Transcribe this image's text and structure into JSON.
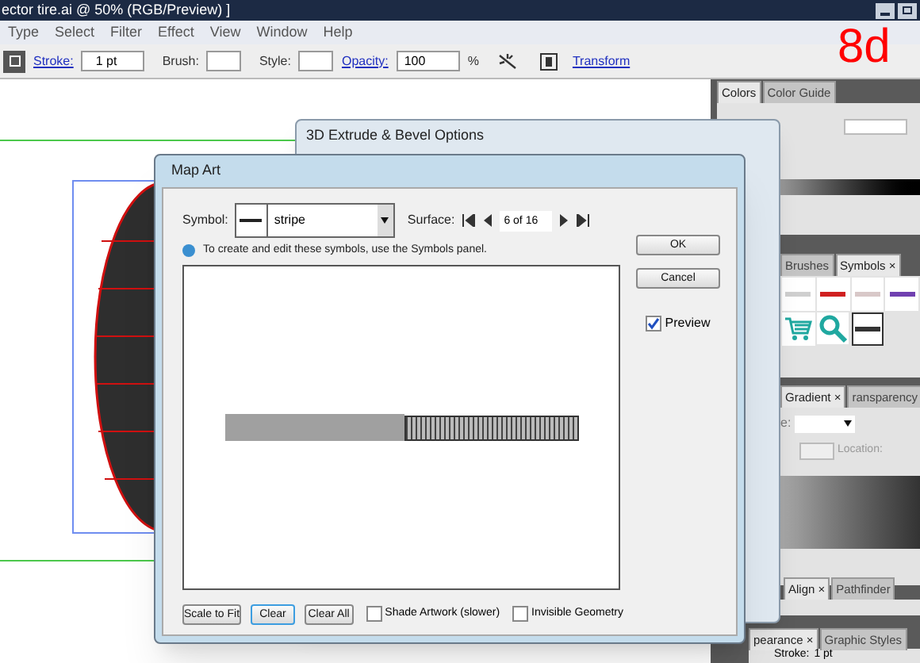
{
  "app_title": "ector tire.ai @ 50% (RGB/Preview) ]",
  "menu": [
    "Type",
    "Select",
    "Filter",
    "Effect",
    "View",
    "Window",
    "Help"
  ],
  "control_bar": {
    "stroke_label": "Stroke:",
    "stroke_value": "1 pt",
    "brush_label": "Brush:",
    "style_label": "Style:",
    "opacity_label": "Opacity:",
    "opacity_value": "100",
    "percent": "%",
    "transform_link": "Transform"
  },
  "annotation": "8d",
  "back_dialog": {
    "title": "3D Extrude & Bevel Options"
  },
  "dialog": {
    "title": "Map Art",
    "symbol_label": "Symbol:",
    "symbol_value": "stripe",
    "surface_label": "Surface:",
    "surface_value": "6 of 16",
    "info": "To create and edit these symbols, use the Symbols panel.",
    "buttons": [
      {
        "label": "OK",
        "focused": false
      },
      {
        "label": "Cancel",
        "focused": false
      }
    ],
    "preview": {
      "label": "Preview",
      "checked": true
    },
    "bottom_buttons": [
      {
        "label": "Scale to Fit",
        "focused": false
      },
      {
        "label": "Clear",
        "focused": true
      },
      {
        "label": "Clear All",
        "focused": false
      }
    ],
    "options": [
      {
        "label": "Shade Artwork (slower)",
        "checked": false
      },
      {
        "label": "Invisible Geometry",
        "checked": false
      }
    ]
  },
  "panels": {
    "color_tabs": [
      {
        "label": "Colors",
        "selected": true
      },
      {
        "label": "Color Guide",
        "selected": false
      }
    ],
    "symbol_tabs": [
      {
        "label": "Brushes",
        "selected": false
      },
      {
        "label": "Symbols ×",
        "selected": true
      }
    ],
    "gradient_tabs": [
      {
        "label": "Gradient ×",
        "selected": true
      },
      {
        "label": "ransparency",
        "selected": false
      }
    ],
    "gradient_type_label": "e:",
    "location_label": "Location:",
    "align_tabs": [
      {
        "label": "Align ×",
        "selected": true
      },
      {
        "label": "Pathfinder",
        "selected": false
      }
    ],
    "appearance_tabs": [
      {
        "label": "pearance ×",
        "selected": true
      },
      {
        "label": "Graphic Styles",
        "selected": false
      }
    ],
    "stroke_label": "Stroke:",
    "stroke_value": "1 pt"
  }
}
